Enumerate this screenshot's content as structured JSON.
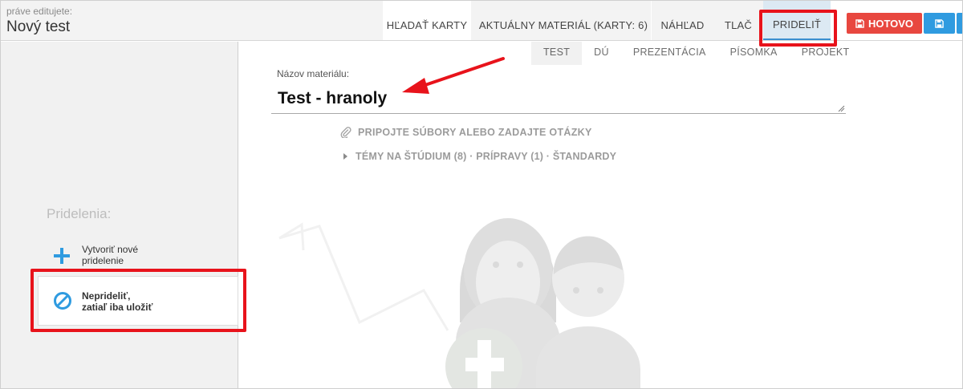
{
  "header": {
    "editing_label": "práve editujete:",
    "document_title": "Nový test",
    "tabs": [
      {
        "label": "HĽADAŤ KARTY"
      },
      {
        "label": "AKTUÁLNY MATERIÁL (KARTY: 6)"
      },
      {
        "label": "NÁHĽAD"
      },
      {
        "label": "TLAČ"
      },
      {
        "label": "PRIDELIŤ",
        "active": true
      }
    ],
    "done_button": "HOTOVO",
    "save_icon": "floppy-disk-icon"
  },
  "material_types": [
    {
      "label": "TEST",
      "active": true
    },
    {
      "label": "DÚ"
    },
    {
      "label": "PREZENTÁCIA"
    },
    {
      "label": "PÍSOMKA"
    },
    {
      "label": "PROJEKT"
    }
  ],
  "material": {
    "name_label": "Názov materiálu:",
    "name_value": "Test - hranoly",
    "attach_text": "PRIPOJTE SÚBORY ALEBO ZADAJTE OTÁZKY",
    "topics_text": "TÉMY NA ŠTÚDIUM (8) · PRÍPRAVY (1) · ŠTANDARDY"
  },
  "sidebar": {
    "heading": "Pridelenia:",
    "items": [
      {
        "line1": "Vytvoriť nové",
        "line2": "pridelenie",
        "icon": "plus-icon"
      },
      {
        "line1": "Neprideliť,",
        "line2": "zatiaľ iba uložiť",
        "icon": "no-entry-icon"
      }
    ]
  },
  "colors": {
    "accent_blue": "#2f9be0",
    "done_red": "#e8473f",
    "annotation_red": "#e8131b",
    "active_tab_bg": "#dce9f3"
  }
}
